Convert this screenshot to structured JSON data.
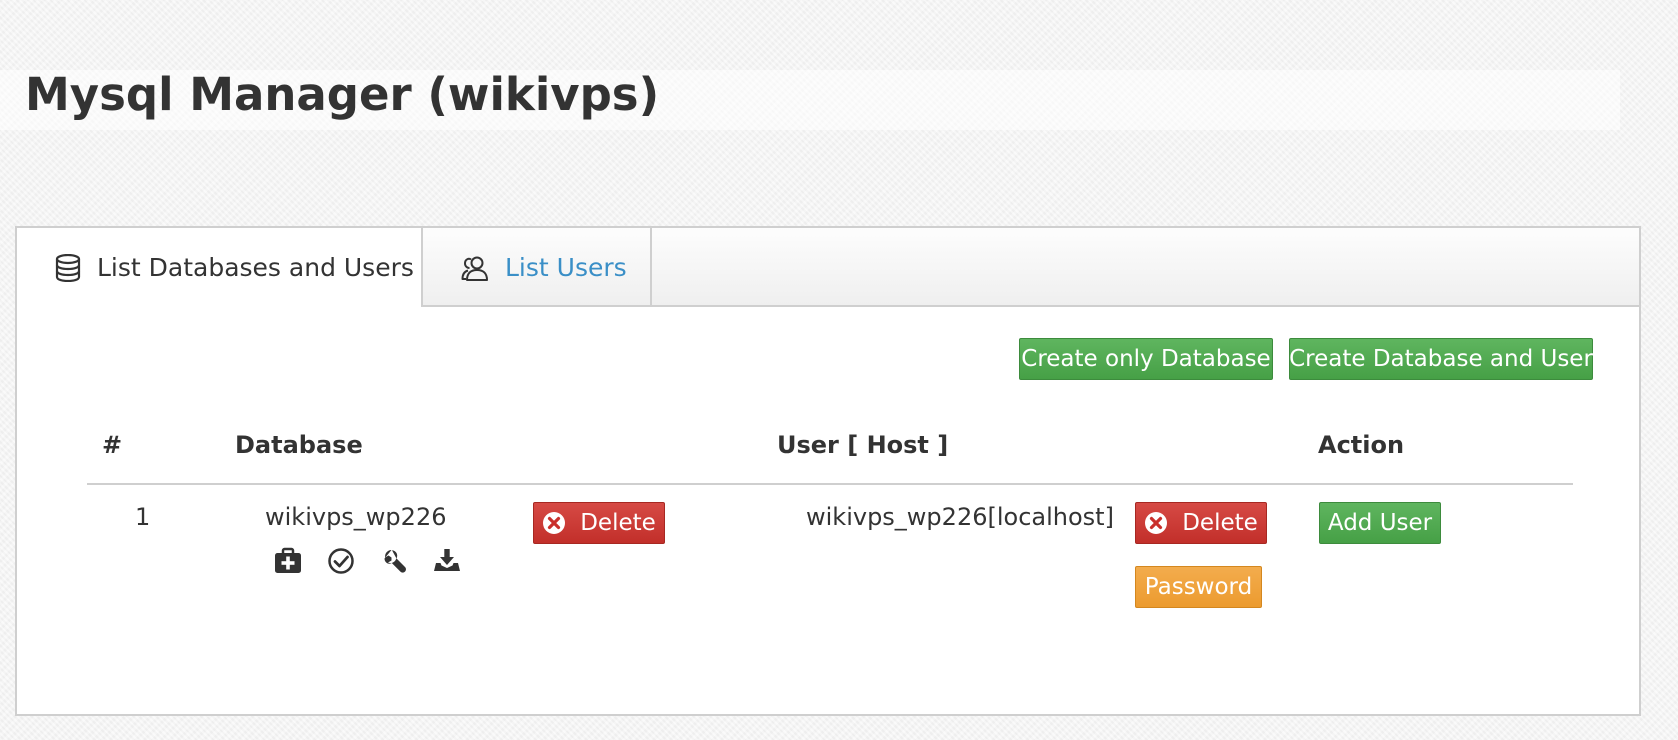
{
  "page": {
    "title": "Mysql Manager (wikivps)"
  },
  "tabs": [
    {
      "label": "List Databases and Users",
      "icon": "database-icon",
      "active": true
    },
    {
      "label": "List Users",
      "icon": "users-icon",
      "active": false
    }
  ],
  "toolbar": {
    "create_db_label": "Create only Database",
    "create_db_user_label": "Create Database and User"
  },
  "table": {
    "columns": [
      "#",
      "Database",
      "User [ Host ]",
      "Action"
    ],
    "rows": [
      {
        "index": "1",
        "database": "wikivps_wp226",
        "db_tools": [
          "medkit-icon",
          "check-circle-icon",
          "wrench-icon",
          "download-tray-icon"
        ],
        "delete_db_label": "Delete",
        "user_host": "wikivps_wp226[localhost]",
        "delete_user_label": "Delete",
        "password_label": "Password",
        "add_user_label": "Add User"
      }
    ]
  },
  "colors": {
    "green": "#4cae4c",
    "red": "#c9302c",
    "orange": "#f0a23a",
    "link_blue": "#3a8fc7",
    "text": "#333333"
  }
}
